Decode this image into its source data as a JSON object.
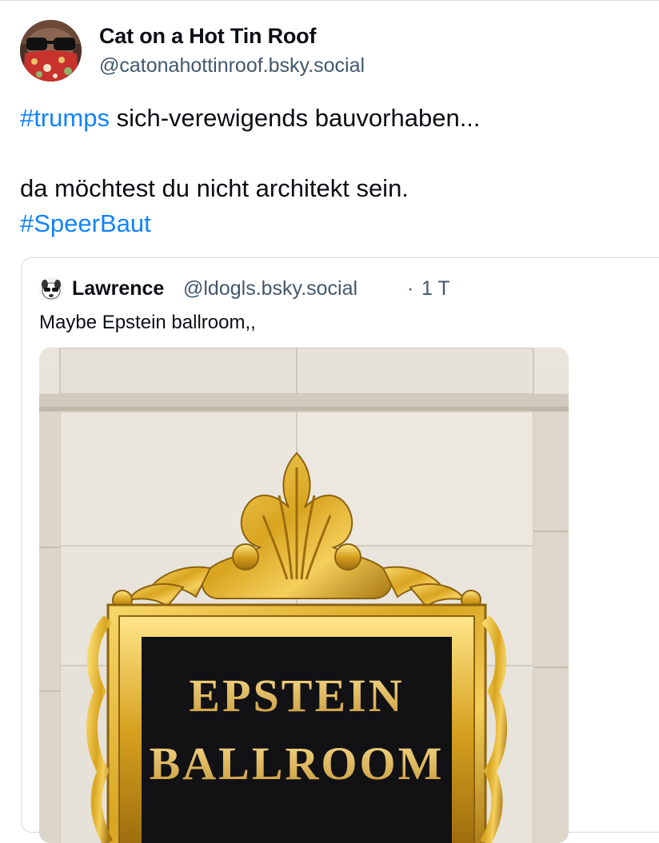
{
  "post": {
    "author": {
      "display_name": "Cat on a Hot Tin Roof",
      "handle": "@catonahottinroof.bsky.social"
    },
    "text": {
      "line1_hashtag": "#trumps",
      "line1_rest": " sich-verewigends bauvorhaben...",
      "line2": "da möchtest du nicht architekt sein.",
      "line3_hashtag": "#SpeerBaut"
    },
    "colors": {
      "link": "#1083fe",
      "handle": "#42576c",
      "border": "#d4dbe2"
    }
  },
  "quote": {
    "author": {
      "display_name": "Lawrence",
      "handle": "@ldogls.bsky.social",
      "separator": "·",
      "time": "1 T"
    },
    "text": "Maybe Epstein ballroom,,",
    "image": {
      "sign_line1": "EPSTEIN",
      "sign_line2": "BALLROOM"
    }
  }
}
